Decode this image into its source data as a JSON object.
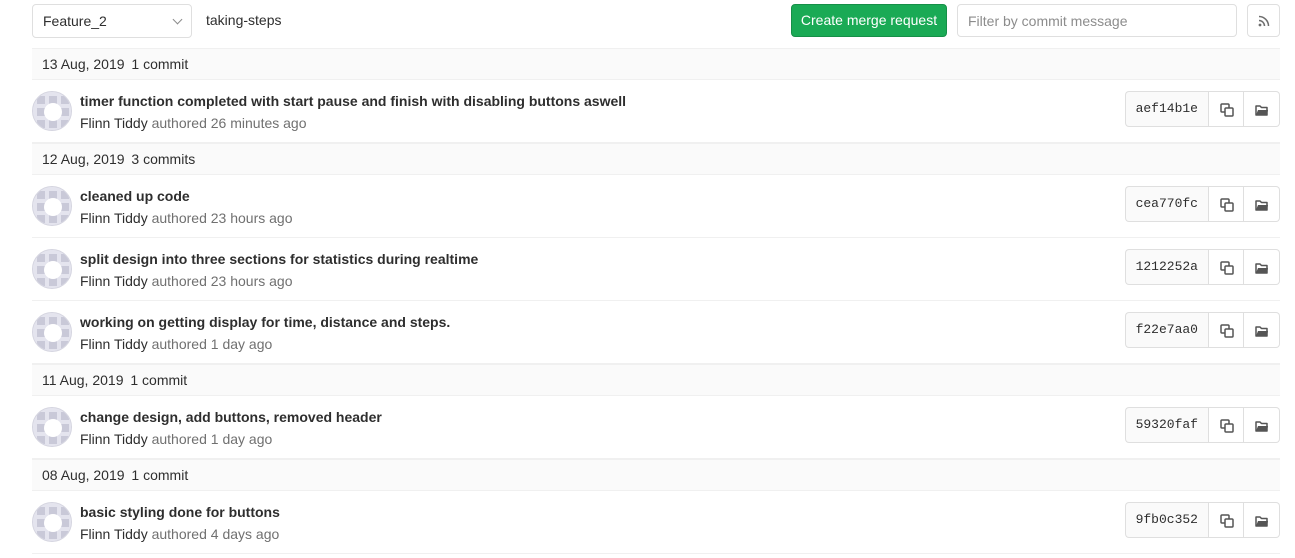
{
  "toolbar": {
    "branch": "Feature_2",
    "path": "taking-steps",
    "create_mr_label": "Create merge request",
    "filter_placeholder": "Filter by commit message",
    "accent_color": "#1aaa55"
  },
  "groups": [
    {
      "date": "13 Aug, 2019",
      "count": "1 commit",
      "commits": [
        {
          "title": "timer function completed with start pause and finish with disabling buttons aswell",
          "author": "Flinn Tiddy",
          "verb": "authored",
          "time": "26 minutes ago",
          "sha": "aef14b1e"
        }
      ]
    },
    {
      "date": "12 Aug, 2019",
      "count": "3 commits",
      "commits": [
        {
          "title": "cleaned up code",
          "author": "Flinn Tiddy",
          "verb": "authored",
          "time": "23 hours ago",
          "sha": "cea770fc"
        },
        {
          "title": "split design into three sections for statistics during realtime",
          "author": "Flinn Tiddy",
          "verb": "authored",
          "time": "23 hours ago",
          "sha": "1212252a"
        },
        {
          "title": "working on getting display for time, distance and steps.",
          "author": "Flinn Tiddy",
          "verb": "authored",
          "time": "1 day ago",
          "sha": "f22e7aa0"
        }
      ]
    },
    {
      "date": "11 Aug, 2019",
      "count": "1 commit",
      "commits": [
        {
          "title": "change design, add buttons, removed header",
          "author": "Flinn Tiddy",
          "verb": "authored",
          "time": "1 day ago",
          "sha": "59320faf"
        }
      ]
    },
    {
      "date": "08 Aug, 2019",
      "count": "1 commit",
      "commits": [
        {
          "title": "basic styling done for buttons",
          "author": "Flinn Tiddy",
          "verb": "authored",
          "time": "4 days ago",
          "sha": "9fb0c352"
        }
      ]
    }
  ],
  "icons": {
    "branch_dropdown": "chevron-down-icon",
    "rss": "rss-icon",
    "copy": "copy-icon",
    "browse": "folder-open-icon",
    "avatar": "identicon-avatar"
  }
}
